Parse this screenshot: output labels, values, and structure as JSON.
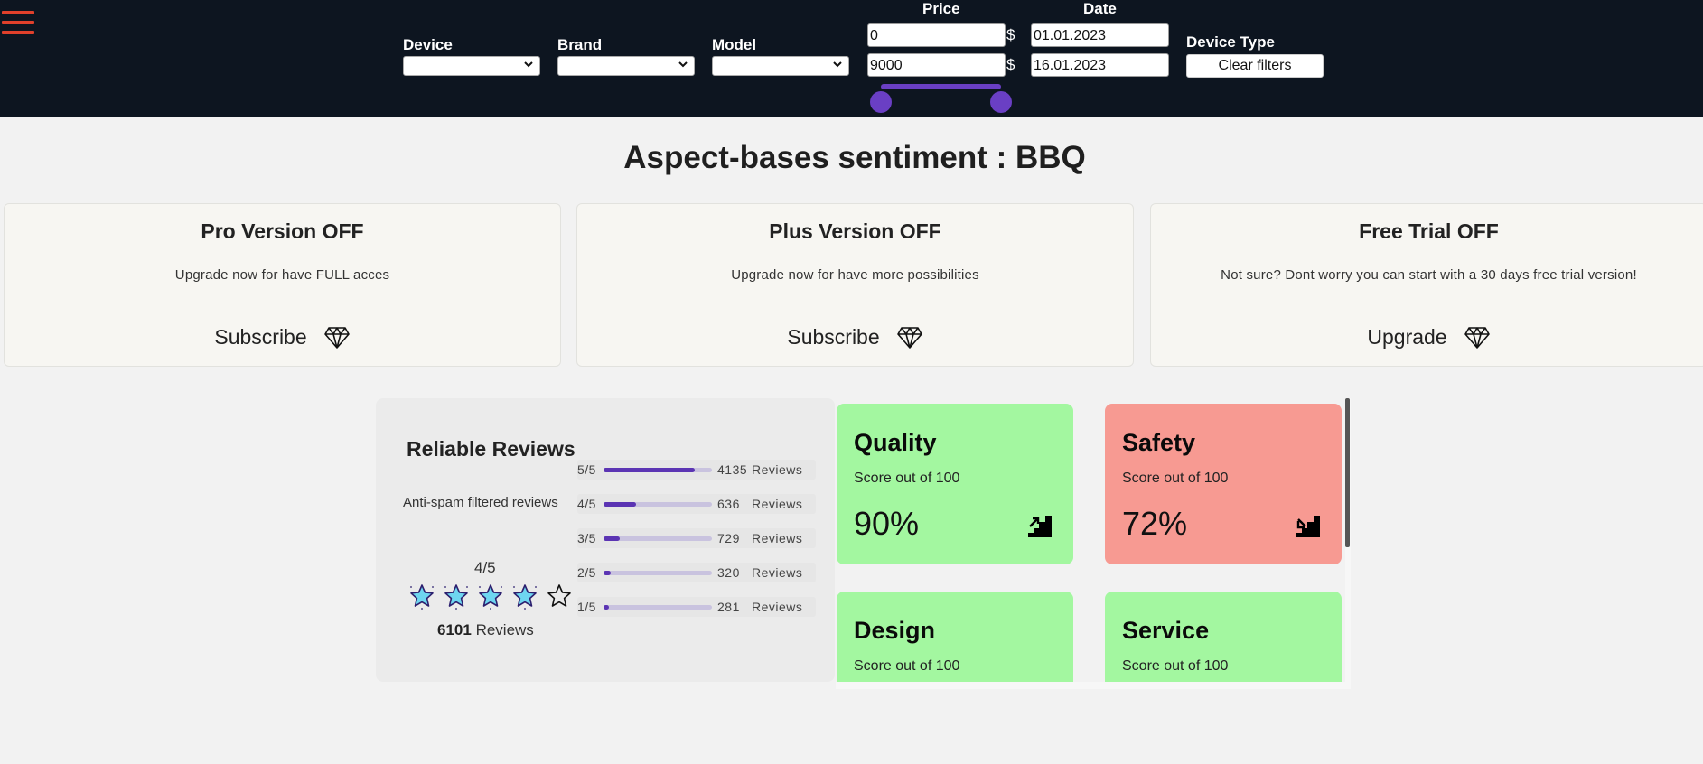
{
  "header": {
    "menu_icon": "hamburger-menu-icon",
    "filters": {
      "device_label": "Device",
      "brand_label": "Brand",
      "model_label": "Model",
      "price_label": "Price",
      "price_min": "0",
      "price_max": "9000",
      "currency": "$",
      "price_range_fraction": [
        0.0,
        1.0
      ],
      "date_label": "Date",
      "date_from": "01.01.2023",
      "date_to": "16.01.2023",
      "device_type_label": "Device Type",
      "clear_label": "Clear filters"
    },
    "colors": {
      "bar_bg": "#0d1520",
      "accent": "#6a3fc4",
      "menu": "#e0402b"
    }
  },
  "page_title": "Aspect-bases sentiment : BBQ",
  "plans": [
    {
      "title": "Pro Version OFF",
      "text": "Upgrade now for have FULL acces",
      "action": "Subscribe",
      "icon": "diamond-icon"
    },
    {
      "title": "Plus Version OFF",
      "text": "Upgrade now for have more possibilities",
      "action": "Subscribe",
      "icon": "diamond-icon"
    },
    {
      "title": "Free Trial OFF",
      "text": "Not sure? Dont worry you can start with a 30 days free trial version!",
      "action": "Upgrade",
      "icon": "diamond-icon"
    }
  ],
  "reviews": {
    "title": "Reliable Reviews",
    "subtitle": "Anti-spam filtered reviews",
    "average": "4/5",
    "stars_filled": 4,
    "stars_total": 5,
    "total_count": "6101",
    "total_suffix": "Reviews",
    "breakdown": [
      {
        "label": "5/5",
        "count": "4135",
        "suffix": "Reviews",
        "fraction": 0.84
      },
      {
        "label": "4/5",
        "count": "636",
        "suffix": "Reviews",
        "fraction": 0.3
      },
      {
        "label": "3/5",
        "count": "729",
        "suffix": "Reviews",
        "fraction": 0.15
      },
      {
        "label": "2/5",
        "count": "320",
        "suffix": "Reviews",
        "fraction": 0.07
      },
      {
        "label": "1/5",
        "count": "281",
        "suffix": "Reviews",
        "fraction": 0.05
      }
    ]
  },
  "score_cards": [
    {
      "title": "Quality",
      "subtitle": "Score out of 100",
      "value": "90%",
      "status": "good",
      "trend_icon": "stairs-up-icon"
    },
    {
      "title": "Safety",
      "subtitle": "Score out of 100",
      "value": "72%",
      "status": "bad",
      "trend_icon": "stairs-down-icon"
    },
    {
      "title": "Design",
      "subtitle": "Score out of 100",
      "status": "good"
    },
    {
      "title": "Service",
      "subtitle": "Score out of 100",
      "status": "good"
    }
  ],
  "status_colors": {
    "good": "#a3f7a0",
    "bad": "#f79a92"
  }
}
